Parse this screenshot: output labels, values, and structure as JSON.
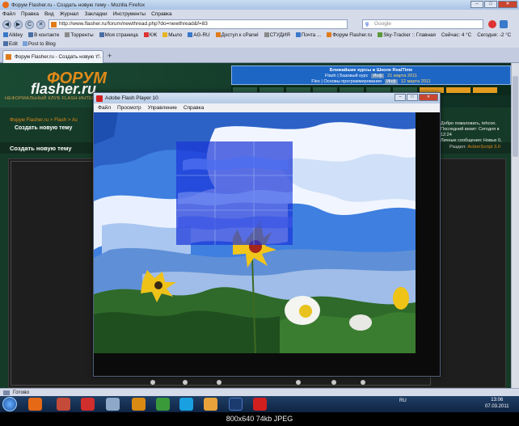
{
  "window": {
    "title": "Форум Flasher.ru - Создать новую тему - Mozilla Firefox",
    "min": "–",
    "max": "□",
    "close": "✕"
  },
  "menu": [
    "Файл",
    "Правка",
    "Вид",
    "Журнал",
    "Закладки",
    "Инструменты",
    "Справка"
  ],
  "nav": {
    "url": "http://www.flasher.ru/forum/newthread.php?do=newthread&f=83",
    "search_placeholder": "Google",
    "back": "◀",
    "forward": "▶",
    "reload": "C",
    "stop": "✕",
    "home": "⌂"
  },
  "bookmarks": [
    "Alldey",
    "В контакте",
    "Торренты",
    "Моя страница",
    "КЖ",
    "Мыло",
    "AG-RU",
    "Доступ к cPanel",
    "СТУДИЯ",
    "Почта ...",
    "Форум Flasher.ru",
    "Sky-Tracker :: Главная",
    "Сейчас: 4 °C",
    "Сегодня: -2 °C"
  ],
  "bookmarks2": [
    "Edit",
    "Post to Blog"
  ],
  "tab": {
    "label": "Форум Flasher.ru - Создать новую т...",
    "close": "×"
  },
  "tab_new": "+",
  "site": {
    "logo_top": "ФОРУМ",
    "logo_main": "flasher.ru",
    "logo_sub": "НЕФОРМАЛЬНЫЙ КЛУБ FLASH-ИНТЕРЕСУЮЩИХСЯ",
    "courses_heading": "Ближайшие курсы в Школе RealTime",
    "course1_name": "Flash | Базовый курс",
    "course1_btn": "Инф",
    "course1_date": "21 марта 2011",
    "course2_name": "Flex | Основы программирования",
    "course2_btn": "Инф",
    "course2_date": "12 марта 2011",
    "breadcrumb": "Форум Flasher.ru > Flash > Ac",
    "page_heading": "Создать новую тему",
    "right_info1": "Добро пожаловать, tehcon.",
    "right_info2": "Последний визит: Сегодня в 12:24",
    "right_info3": "Личные сообщения: Новых 0, всего 26.",
    "section_title": "Создать новую тему",
    "section_right_label": "Раздел:",
    "section_right_value": "ActionScript 3.0"
  },
  "flash_window": {
    "title": "Adobe Flash Player 10",
    "menu": [
      "Файл",
      "Просмотр",
      "Управление",
      "Справка"
    ],
    "min": "–",
    "max": "□",
    "close": "✕"
  },
  "status": {
    "text": "Готово"
  },
  "tray": {
    "lang": "RU",
    "time": "13:06",
    "date": "07.03.2011"
  },
  "caption": "800x640  74kb  JPEG",
  "colors": {
    "site_green": "#163a28",
    "accent_orange": "#e08a1a",
    "courses_blue": "#1d66c4",
    "selection_blue": "#1a34d8"
  }
}
